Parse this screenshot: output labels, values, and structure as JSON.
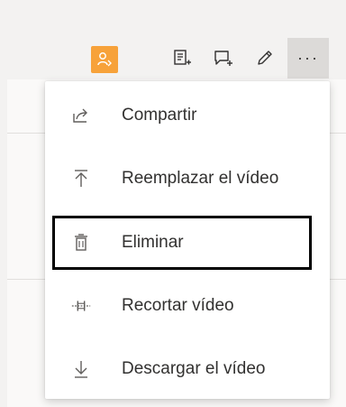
{
  "toolbar": {
    "icons": [
      "person-badge-icon",
      "notes-icon",
      "comment-add-icon",
      "pencil-icon"
    ],
    "more_label": "···",
    "badge_color": "#f7a23a"
  },
  "menu": {
    "items": [
      {
        "label": "Compartir",
        "icon": "share-icon"
      },
      {
        "label": "Reemplazar el vídeo",
        "icon": "upload-icon"
      },
      {
        "label": "Eliminar",
        "icon": "trash-icon"
      },
      {
        "label": "Recortar vídeo",
        "icon": "trim-icon"
      },
      {
        "label": "Descargar el vídeo",
        "icon": "download-icon"
      }
    ]
  }
}
